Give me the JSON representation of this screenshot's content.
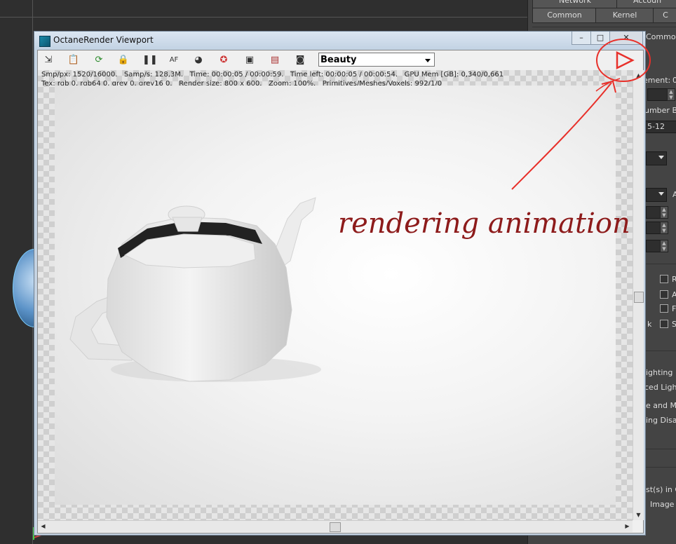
{
  "background_panel": {
    "tabs_row1": [
      "Network",
      "Accoun"
    ],
    "tabs_row2": [
      "Common",
      "Kernel",
      "C"
    ],
    "common_tab": "Common",
    "labels": [
      "ement:",
      "0",
      "umber Ba",
      "5-12",
      "A",
      "R",
      "A",
      "F",
      "k",
      "S",
      "ighting",
      "ced Light",
      "e and Me",
      "ing Disab",
      "st(s) in C",
      "Image S"
    ]
  },
  "octane_window": {
    "title": "OctaneRender Viewport",
    "buttons": {
      "minimize": "–",
      "maximize": "□",
      "close": "✕"
    },
    "render_pass": "Beauty",
    "stats_line1": "Smp/px: 1520/16000.   Samp/s: 128,3M.   Time: 00:00:05 / 00:00:59.   Time left: 00:00:05 / 00:00:54.   GPU Mem [GB]: 0,340/0,661",
    "stats_line2": "Tex: rgb 0, rgb64 0, grey 0, grey16 0.   Render size: 800 x 600.   Zoom: 100%.   Primitives/Meshes/Voxels: 992/1/0",
    "toolbar_icons": [
      "export-icon",
      "clipboard-icon",
      "refresh-icon",
      "lock-icon",
      "pause-icon",
      "autofocus-icon",
      "color-picker-icon",
      "clay-mode-icon",
      "region-render-icon",
      "film-icon",
      "camera-icon"
    ]
  },
  "annotation": {
    "text": "rendering animation",
    "color": "#8d1b1b",
    "mark_color": "#e8302a"
  }
}
